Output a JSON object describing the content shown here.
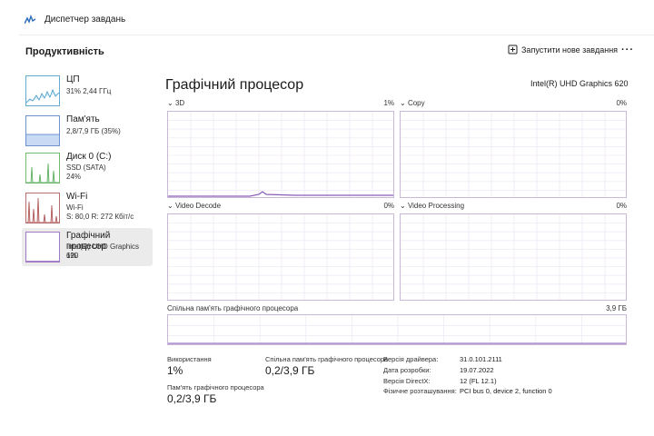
{
  "app": {
    "title": "Диспетчер завдань"
  },
  "page": {
    "section_title": "Продуктивність",
    "new_task_label": "Запустити нове завдання",
    "more_label": "···"
  },
  "sidebar": {
    "items": [
      {
        "name": "ЦП",
        "sub1": "31% 2,44 ГГц",
        "sub2": "",
        "sub3": "",
        "color": "#3f97c7",
        "active": false
      },
      {
        "name": "Пам'ять",
        "sub1": "2,8/7,9 ГБ (35%)",
        "sub2": "",
        "sub3": "",
        "color": "#4a76c4",
        "active": false
      },
      {
        "name": "Диск 0 (C:)",
        "sub1": "SSD (SATA)",
        "sub2": "24%",
        "sub3": "",
        "color": "#4fa84f",
        "active": false
      },
      {
        "name": "Wi-Fi",
        "sub1": "Wi-Fi",
        "sub2": "S: 80,0 R: 272 Кбіт/с",
        "sub3": "",
        "color": "#a84a4a",
        "active": false
      },
      {
        "name": "Графічний процесор",
        "sub1": "Intel(R) UHD Graphics 620",
        "sub2": "1%",
        "sub3": "",
        "color": "#8b5cb8",
        "active": true
      }
    ]
  },
  "main": {
    "title": "Графічний процесор",
    "gpu_name": "Intel(R) UHD Graphics 620",
    "graphs": [
      {
        "label": "3D",
        "pct": "1%"
      },
      {
        "label": "Copy",
        "pct": "0%"
      },
      {
        "label": "Video Decode",
        "pct": "0%"
      },
      {
        "label": "Video Processing",
        "pct": "0%"
      }
    ],
    "shared_memory": {
      "label": "Спільна пам'ять графічного процесора",
      "value": "3,9 ГБ"
    },
    "accent_color": "#8b5cb8",
    "grid_color": "#efeaf5"
  },
  "stats": {
    "usage_label": "Використання",
    "usage_value": "1%",
    "shared_label": "Спільна пам'ять графічного процесора",
    "shared_value": "0,2/3,9 ГБ",
    "gpu_mem_label": "Пам'ять графічного процесора",
    "gpu_mem_value": "0,2/3,9 ГБ"
  },
  "info": {
    "driver_version_label": "Версія драйвера:",
    "driver_version_value": "31.0.101.2111",
    "driver_date_label": "Дата розробки:",
    "driver_date_value": "19.07.2022",
    "directx_label": "Версія DirectX:",
    "directx_value": "12 (FL 12.1)",
    "location_label": "Фізичне розташування:",
    "location_value": "PCI bus 0, device 2, function 0"
  }
}
